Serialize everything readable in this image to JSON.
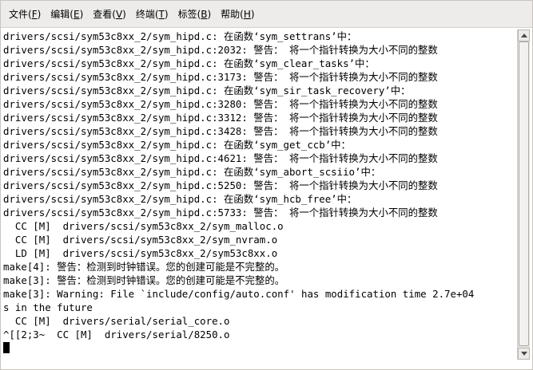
{
  "menu": [
    {
      "label": "文件(",
      "key": "F",
      "suffix": ")"
    },
    {
      "label": "编辑(",
      "key": "E",
      "suffix": ")"
    },
    {
      "label": "查看(",
      "key": "V",
      "suffix": ")"
    },
    {
      "label": "终端(",
      "key": "T",
      "suffix": ")"
    },
    {
      "label": "标签(",
      "key": "B",
      "suffix": ")"
    },
    {
      "label": "帮助(",
      "key": "H",
      "suffix": ")"
    }
  ],
  "terminal": {
    "lines": [
      "drivers/scsi/sym53c8xx_2/sym_hipd.c: 在函数‘sym_settrans’中：",
      "drivers/scsi/sym53c8xx_2/sym_hipd.c:2032: 警告： 将一个指针转换为大小不同的整数",
      "drivers/scsi/sym53c8xx_2/sym_hipd.c: 在函数‘sym_clear_tasks’中：",
      "drivers/scsi/sym53c8xx_2/sym_hipd.c:3173: 警告： 将一个指针转换为大小不同的整数",
      "drivers/scsi/sym53c8xx_2/sym_hipd.c: 在函数‘sym_sir_task_recovery’中：",
      "drivers/scsi/sym53c8xx_2/sym_hipd.c:3280: 警告： 将一个指针转换为大小不同的整数",
      "drivers/scsi/sym53c8xx_2/sym_hipd.c:3312: 警告： 将一个指针转换为大小不同的整数",
      "drivers/scsi/sym53c8xx_2/sym_hipd.c:3428: 警告： 将一个指针转换为大小不同的整数",
      "drivers/scsi/sym53c8xx_2/sym_hipd.c: 在函数‘sym_get_ccb’中：",
      "drivers/scsi/sym53c8xx_2/sym_hipd.c:4621: 警告： 将一个指针转换为大小不同的整数",
      "drivers/scsi/sym53c8xx_2/sym_hipd.c: 在函数‘sym_abort_scsiio’中：",
      "drivers/scsi/sym53c8xx_2/sym_hipd.c:5250: 警告： 将一个指针转换为大小不同的整数",
      "drivers/scsi/sym53c8xx_2/sym_hipd.c: 在函数‘sym_hcb_free’中：",
      "drivers/scsi/sym53c8xx_2/sym_hipd.c:5733: 警告： 将一个指针转换为大小不同的整数",
      "  CC [M]  drivers/scsi/sym53c8xx_2/sym_malloc.o",
      "  CC [M]  drivers/scsi/sym53c8xx_2/sym_nvram.o",
      "  LD [M]  drivers/scsi/sym53c8xx_2/sym53c8xx.o",
      "make[4]: 警告：检测到时钟错误。您的创建可能是不完整的。",
      "make[3]: 警告：检测到时钟错误。您的创建可能是不完整的。",
      "make[3]: Warning: File `include/config/auto.conf' has modification time 2.7e+04",
      "s in the future",
      "  CC [M]  drivers/serial/serial_core.o",
      "^[[2;3~  CC [M]  drivers/serial/8250.o"
    ]
  }
}
